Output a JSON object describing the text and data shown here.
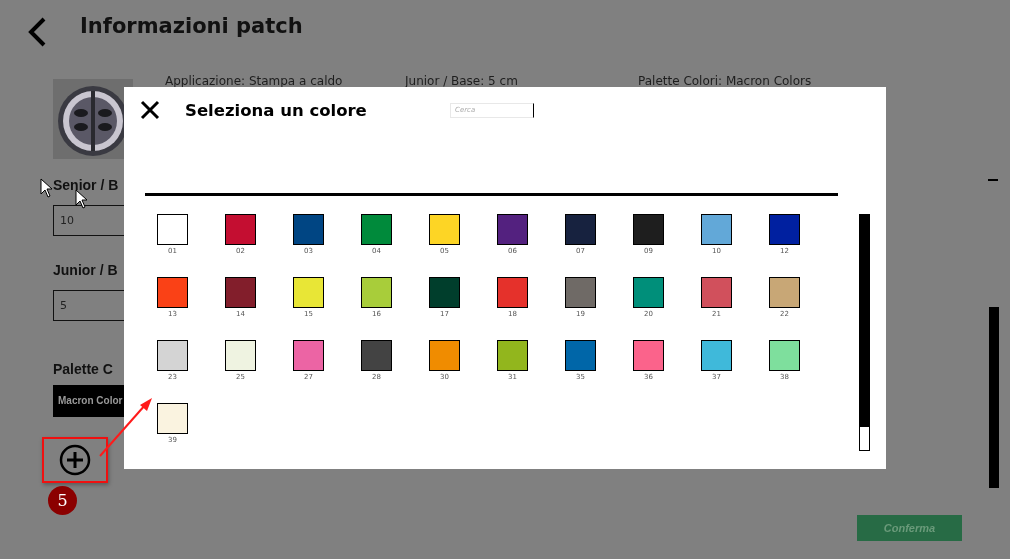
{
  "page": {
    "title": "Informazioni patch",
    "info": [
      "Applicazione: Stampa a caldo",
      "Junior / Base: 5 cm",
      "Palette Colori: Macron Colors"
    ],
    "fields": [
      {
        "label": "Senior / B",
        "value": "10"
      },
      {
        "label": "Junior / B",
        "value": "5"
      }
    ],
    "palette_label": "Palette C",
    "palette_value": "Macron Color",
    "confirm_button": "Conferma"
  },
  "annotation": {
    "badge": "5"
  },
  "dialog": {
    "title": "Seleziona un colore",
    "search": {
      "placeholder": "Cerca"
    },
    "swatches": [
      {
        "label": "01",
        "color": "#ffffff"
      },
      {
        "label": "02",
        "color": "#c40e31"
      },
      {
        "label": "03",
        "color": "#004583"
      },
      {
        "label": "04",
        "color": "#008a3b"
      },
      {
        "label": "05",
        "color": "#fdd525"
      },
      {
        "label": "06",
        "color": "#53217f"
      },
      {
        "label": "07",
        "color": "#17223f"
      },
      {
        "label": "09",
        "color": "#1e1e1e"
      },
      {
        "label": "10",
        "color": "#62a8d8"
      },
      {
        "label": "12",
        "color": "#0020a0"
      },
      {
        "label": "13",
        "color": "#fa4116"
      },
      {
        "label": "14",
        "color": "#821e2b"
      },
      {
        "label": "15",
        "color": "#e8e636"
      },
      {
        "label": "16",
        "color": "#a8cd3a"
      },
      {
        "label": "17",
        "color": "#003e2c"
      },
      {
        "label": "18",
        "color": "#e5312b"
      },
      {
        "label": "19",
        "color": "#6f6a66"
      },
      {
        "label": "20",
        "color": "#008f7a"
      },
      {
        "label": "21",
        "color": "#d1505c"
      },
      {
        "label": "22",
        "color": "#c8a776"
      },
      {
        "label": "23",
        "color": "#d4d4d4"
      },
      {
        "label": "25",
        "color": "#eff3e1"
      },
      {
        "label": "27",
        "color": "#ec64a4"
      },
      {
        "label": "28",
        "color": "#434343"
      },
      {
        "label": "30",
        "color": "#f08c00"
      },
      {
        "label": "31",
        "color": "#92b61d"
      },
      {
        "label": "35",
        "color": "#0066a8"
      },
      {
        "label": "36",
        "color": "#fb638b"
      },
      {
        "label": "37",
        "color": "#3fb9da"
      },
      {
        "label": "38",
        "color": "#7edf9d"
      },
      {
        "label": "39",
        "color": "#faf3e0"
      }
    ]
  }
}
